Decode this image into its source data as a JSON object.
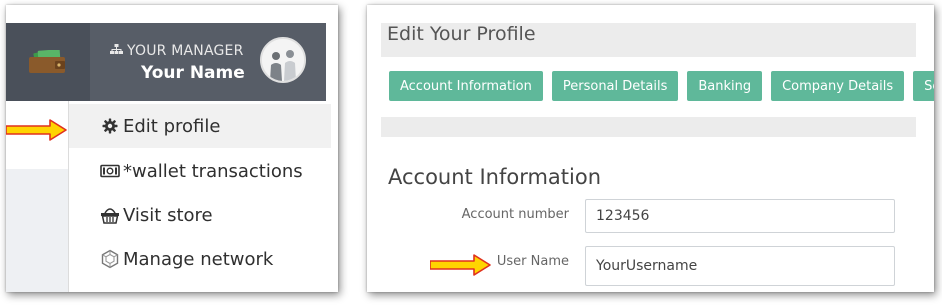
{
  "manager_panel": {
    "label": "YOUR MANAGER",
    "name": "Your Name"
  },
  "menu": {
    "items": [
      {
        "label": "Edit profile",
        "icon": "gear-icon"
      },
      {
        "label": "*wallet transactions",
        "icon": "money-icon"
      },
      {
        "label": "Visit store",
        "icon": "basket-icon"
      },
      {
        "label": "Manage network",
        "icon": "network-icon"
      }
    ]
  },
  "profile": {
    "page_title": "Edit Your Profile",
    "tabs": [
      "Account Information",
      "Personal Details",
      "Banking",
      "Company Details",
      "Secu"
    ],
    "section_title": "Account Information",
    "fields": [
      {
        "label": "Account number",
        "value": "123456"
      },
      {
        "label": "User Name",
        "value": "YourUsername"
      }
    ]
  },
  "colors": {
    "topbar_dark": "#4a505a",
    "topbar": "#575d67",
    "tab_green": "#5fb89a",
    "arrow_yellow": "#ffd400",
    "arrow_outline": "#e0301e"
  }
}
